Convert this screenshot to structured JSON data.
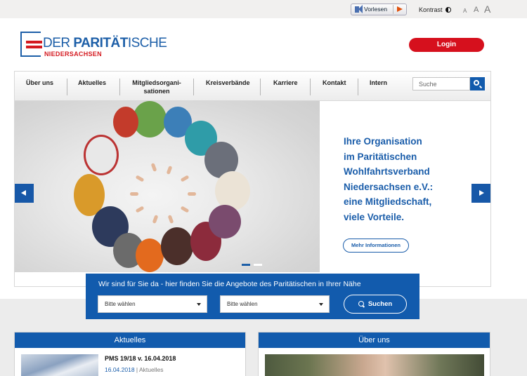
{
  "topbar": {
    "readspeaker_label": "Vorlesen",
    "contrast_label": "Kontrast",
    "font_sizes": [
      "A",
      "A",
      "A"
    ]
  },
  "logo": {
    "main_prefix": "DER ",
    "main_bold": "PARITÄT",
    "main_suffix": "ISCHE",
    "sub": "NIEDERSACHSEN"
  },
  "login": {
    "label": "Login"
  },
  "nav": {
    "items": [
      {
        "line1": "Über uns",
        "line2": ""
      },
      {
        "line1": "Aktuelles",
        "line2": ""
      },
      {
        "line1": "Mitgliedsorgani-",
        "line2": "sationen"
      },
      {
        "line1": "Kreisverbände",
        "line2": ""
      },
      {
        "line1": "Karriere",
        "line2": ""
      },
      {
        "line1": "Kontakt",
        "line2": ""
      },
      {
        "line1": "Intern",
        "line2": ""
      }
    ],
    "search_placeholder": "Suche"
  },
  "hero": {
    "lines": [
      "Ihre Organisation",
      "im Paritätischen",
      "Wohlfahrtsverband",
      "Niedersachsen e.V.:",
      "eine Mitgliedschaft,",
      "viele Vorteile."
    ],
    "more_label": "Mehr Informationen",
    "slides": 2,
    "active_slide": 1
  },
  "finder": {
    "title": "Wir sind für Sie da - hier finden Sie die Angebote des Paritätischen in Ihrer Nähe",
    "select1": "Bitte wählen",
    "select2": "Bitte wählen",
    "button": "Suchen"
  },
  "news": {
    "heading": "Aktuelles",
    "item_title": "PMS 19/18 v. 16.04.2018",
    "item_date": "16.04.2018",
    "item_sep": " | ",
    "item_category": "Aktuelles"
  },
  "about": {
    "heading": "Über uns"
  },
  "colors": {
    "brand_blue": "#125bad",
    "brand_red": "#d6101d"
  }
}
